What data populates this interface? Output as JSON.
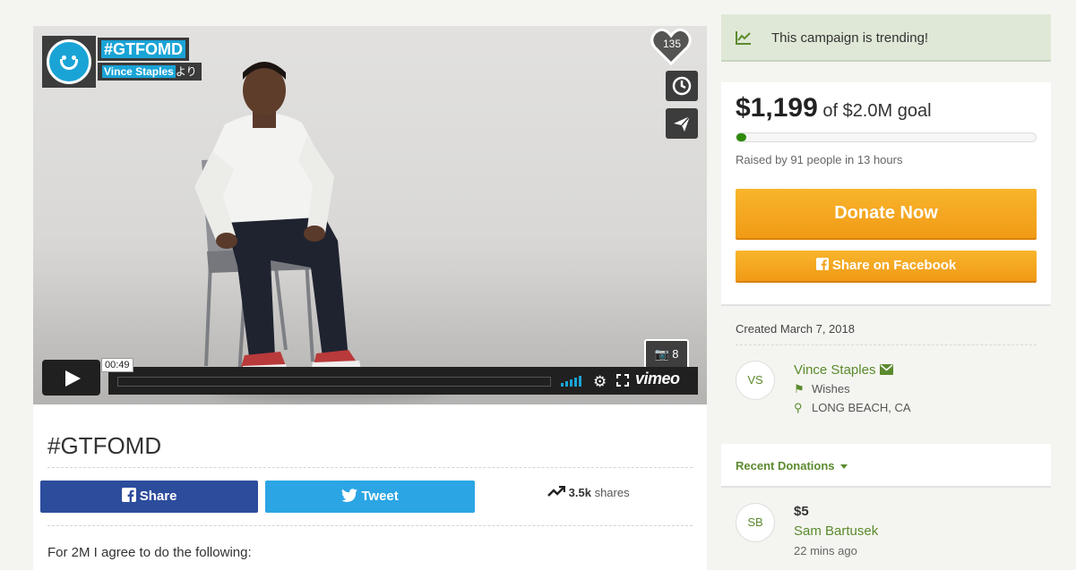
{
  "video": {
    "channel_title": "#GTFOMD",
    "channel_author": "Vince Staples",
    "channel_suffix": "より",
    "like_count": "135",
    "current_time": "00:49",
    "photo_count": "8",
    "player_brand": "vimeo"
  },
  "campaign": {
    "title": "#GTFOMD",
    "share_fb_label": "Share",
    "tweet_label": "Tweet",
    "shares_count": "3.5k",
    "shares_label": "shares",
    "description": "For 2M I agree to do the following:"
  },
  "sidebar": {
    "trending_text": "This campaign is trending!",
    "amount_raised": "$1,199",
    "goal_text": "of $2.0M goal",
    "progress_fraction": 0.0006,
    "raised_by": "Raised by 91 people in 13 hours",
    "donate_label": "Donate Now",
    "share_facebook_label": "Share on Facebook",
    "created": "Created March 7, 2018",
    "organizer": {
      "initials": "VS",
      "name": "Vince Staples",
      "category": "Wishes",
      "location": "LONG BEACH, CA"
    },
    "recent_label": "Recent Donations",
    "donations": [
      {
        "initials": "SB",
        "amount": "$5",
        "name": "Sam Bartusek",
        "time": "22 mins ago"
      }
    ]
  },
  "colors": {
    "brand_green": "#5b8a2e",
    "donate_orange": "#f4a41f",
    "facebook_blue": "#2c4c9c",
    "twitter_blue": "#2ba5e4",
    "trending_bg": "#dfe8d6"
  },
  "icons": [
    "trending-up-icon",
    "heart-icon",
    "clock-icon",
    "send-icon",
    "camera-icon",
    "play-icon",
    "volume-icon",
    "settings-icon",
    "fullscreen-icon",
    "facebook-icon",
    "twitter-icon",
    "share-arrow-icon",
    "envelope-icon",
    "tag-icon",
    "map-pin-icon",
    "caret-down-icon"
  ]
}
